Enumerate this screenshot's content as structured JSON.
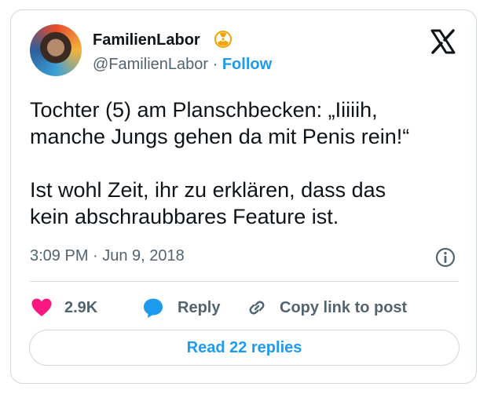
{
  "author": {
    "display_name": "FamilienLabor",
    "handle": "@FamilienLabor",
    "separator": "·",
    "follow_label": "Follow"
  },
  "tweet": {
    "text": "Tochter (5) am Planschbecken: „Iiiiih,\nmanche Jungs gehen da mit Penis rein!“\n\nIst wohl Zeit, ihr zu erklären, dass das\nkein abschraubbares Feature ist.",
    "timestamp": "3:09 PM · Jun 9, 2018"
  },
  "actions": {
    "like_count": "2.9K",
    "reply_label": "Reply",
    "copy_link_label": "Copy link to post"
  },
  "footer": {
    "read_replies_label": "Read 22 replies"
  },
  "colors": {
    "accent": "#1d9bf0",
    "like": "#f91880",
    "badge": "#f4a300",
    "text": "#0f1419",
    "muted": "#536471",
    "border": "#cfd9de"
  },
  "icons": [
    "avatar",
    "radioactive-badge-icon",
    "x-logo-icon",
    "info-icon",
    "heart-icon",
    "reply-bubble-icon",
    "link-icon"
  ]
}
